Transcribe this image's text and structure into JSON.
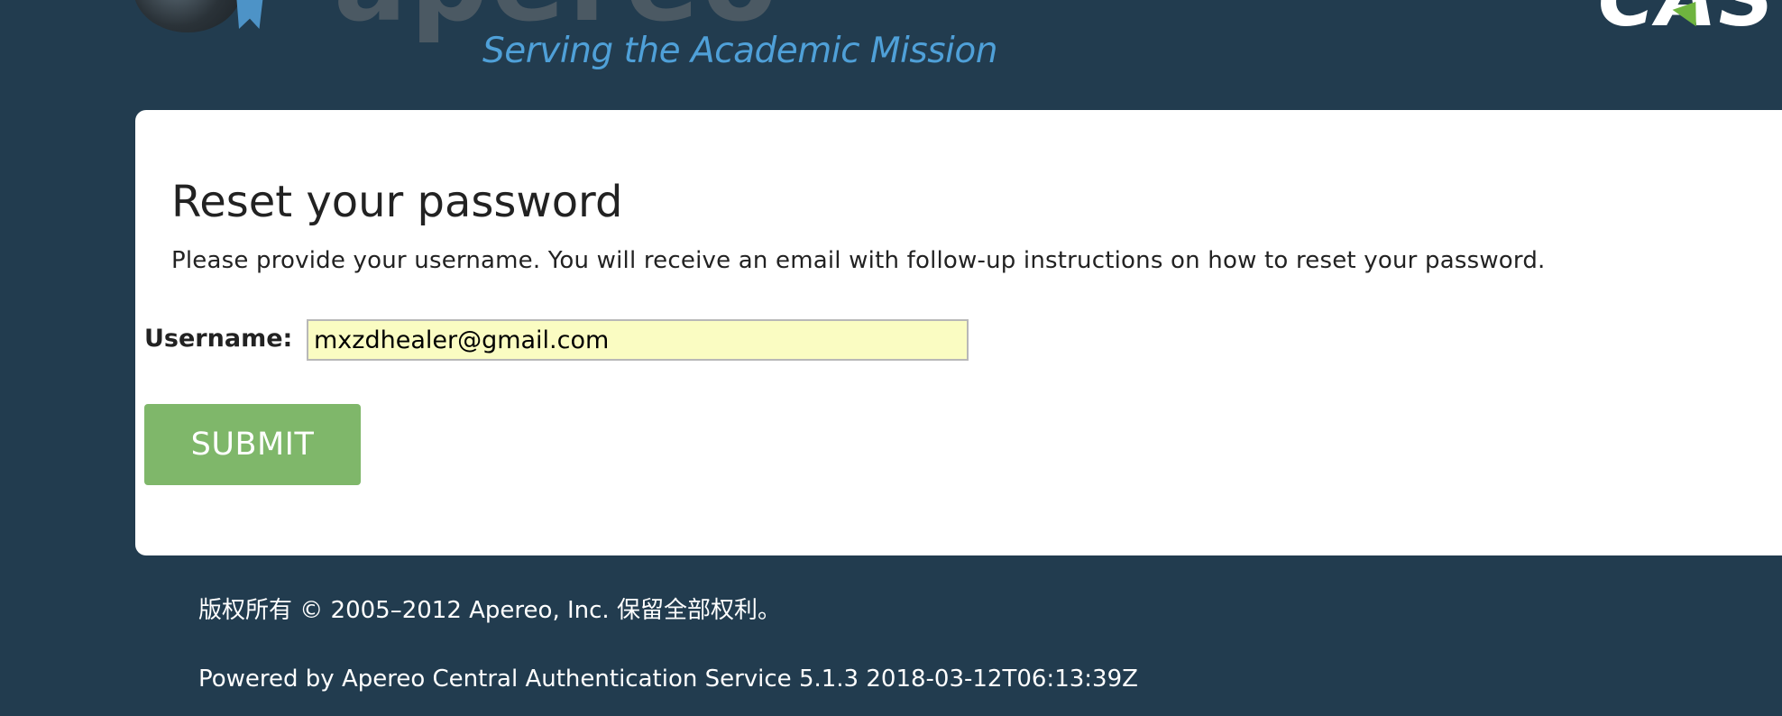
{
  "header": {
    "logo_word": "apereo",
    "tagline": "Serving the Academic Mission",
    "cas_logo": "CAS"
  },
  "main": {
    "title": "Reset your password",
    "instructions": "Please provide your username. You will receive an email with follow-up instructions on how to reset your password.",
    "username_label": "Username:",
    "username_value": "mxzdhealer@gmail.com",
    "submit_label": "SUBMIT"
  },
  "footer": {
    "copyright": "版权所有 © 2005–2012 Apereo, Inc. 保留全部权利。",
    "powered_by": "Powered by Apereo Central Authentication Service 5.1.3 2018-03-12T06:13:39Z"
  },
  "colors": {
    "background": "#223c4f",
    "tagline": "#4fa0d8",
    "submit_button": "#7fb76a",
    "input_background": "#fafcc2"
  }
}
